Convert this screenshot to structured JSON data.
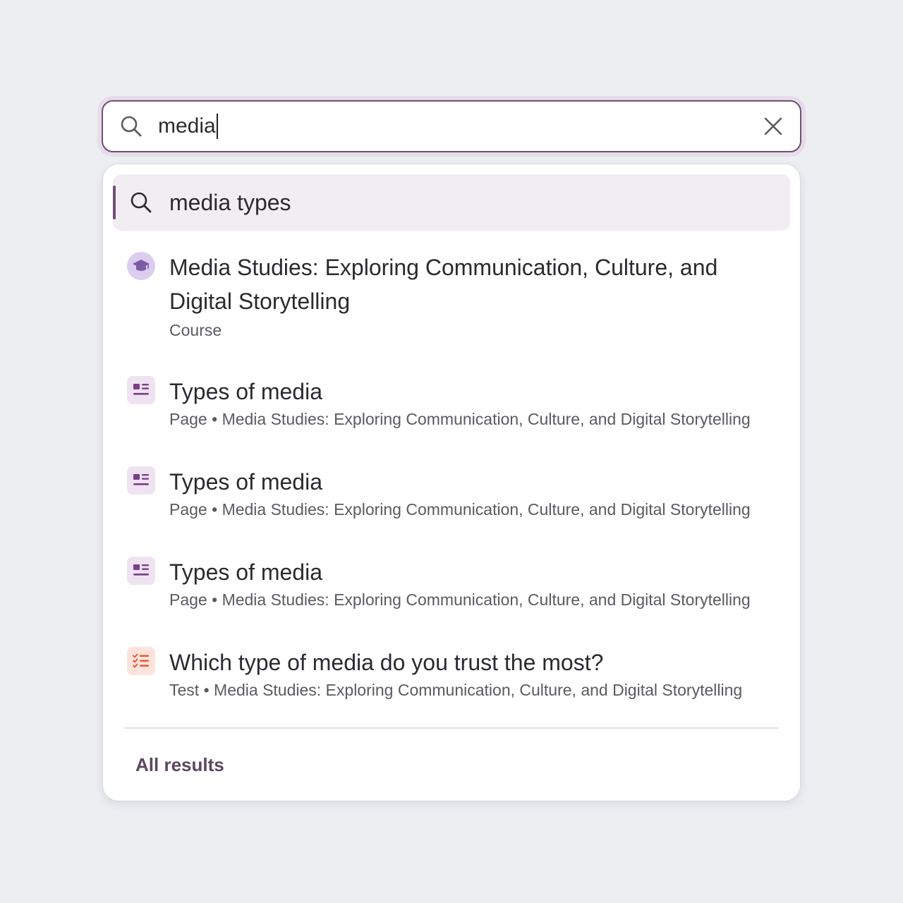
{
  "search": {
    "value": "media",
    "clear_label": "Clear search"
  },
  "suggestion": {
    "text": "media types"
  },
  "results": [
    {
      "icon": "graduation-cap-icon",
      "title": "Media Studies: Exploring Communication, Culture, and Digital Storytelling",
      "type": "Course",
      "context": ""
    },
    {
      "icon": "page-icon",
      "title": "Types of media",
      "type": "Page",
      "context": "Media Studies: Exploring Communication, Culture, and Digital Storytelling"
    },
    {
      "icon": "page-icon",
      "title": "Types of media",
      "type": "Page",
      "context": "Media Studies: Exploring Communication, Culture, and Digital Storytelling"
    },
    {
      "icon": "page-icon",
      "title": "Types of media",
      "type": "Page",
      "context": "Media Studies: Exploring Communication, Culture, and Digital Storytelling"
    },
    {
      "icon": "checklist-icon",
      "title": "Which type of media do you trust the most?",
      "type": "Test",
      "context": "Media Studies: Exploring Communication, Culture, and Digital Storytelling"
    }
  ],
  "separator": "•",
  "footer": {
    "all_results_label": "All results"
  },
  "colors": {
    "accent": "#6f4f74",
    "course_icon_bg": "#dccdf0",
    "course_icon": "#7a5aa6",
    "page_icon_bg": "#efe3f1",
    "page_icon": "#7a3f8a",
    "test_icon_bg": "#fde3dc",
    "test_icon": "#e8502a",
    "background": "#eceef2"
  }
}
